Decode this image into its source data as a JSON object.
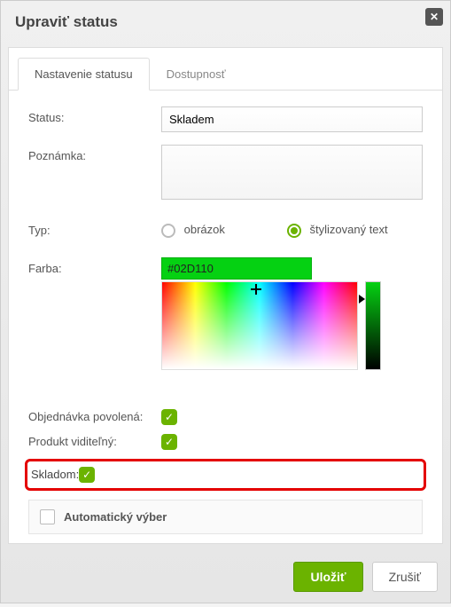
{
  "dialog": {
    "title": "Upraviť status"
  },
  "tabs": {
    "settings": "Nastavenie statusu",
    "availability": "Dostupnosť"
  },
  "form": {
    "status_label": "Status:",
    "status_value": "Skladem",
    "note_label": "Poznámka:",
    "type_label": "Typ:",
    "type_image": "obrázok",
    "type_styled": "štylizovaný text",
    "color_label": "Farba:",
    "color_hex": "#02D110",
    "order_allowed_label": "Objednávka povolená:",
    "product_visible_label": "Produkt viditeľný:",
    "in_stock_label": "Skladom:",
    "auto_select_label": "Automatický výber"
  },
  "footer": {
    "save": "Uložiť",
    "cancel": "Zrušiť"
  },
  "glyph": {
    "check": "✓",
    "close": "✕"
  }
}
